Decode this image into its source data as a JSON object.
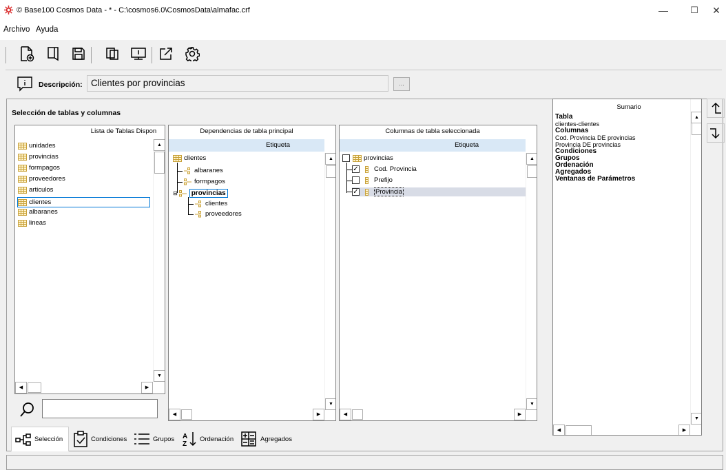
{
  "window": {
    "title": "© Base100 Cosmos Data - * - C:\\cosmos6.0\\CosmosData\\almafac.crf",
    "minimize": "—",
    "maximize": "☐",
    "close": "✕"
  },
  "menu": [
    "Archivo",
    "Ayuda"
  ],
  "toolbar_icons": [
    "new-doc-icon",
    "open-icon",
    "save-icon",
    "copy-icon",
    "preview-icon",
    "export-icon",
    "settings-icon"
  ],
  "description": {
    "label": "Descripción:",
    "value": "Clientes por provincias",
    "button": "..."
  },
  "section_title": "Selección de tablas y columnas",
  "tables_panel": {
    "header": "Lista de Tablas Dispon",
    "items": [
      "unidades",
      "provincias",
      "formpagos",
      "proveedores",
      "articulos",
      "clientes",
      "albaranes",
      "lineas"
    ],
    "selected": "clientes"
  },
  "dependencies_panel": {
    "header": "Dependencias de tabla principal",
    "subheader": "Etiqueta",
    "root": "clientes",
    "children": [
      "albaranes",
      "formpagos",
      "provincias"
    ],
    "selected": "provincias",
    "grandchildren": [
      "clientes",
      "proveedores"
    ]
  },
  "columns_panel": {
    "header": "Columnas de tabla seleccionada",
    "subheader": "Etiqueta",
    "root": "provincias",
    "columns": [
      {
        "label": "Cod. Provincia",
        "checked": true
      },
      {
        "label": "Prefijo",
        "checked": false
      },
      {
        "label": "Provincia",
        "checked": true
      }
    ]
  },
  "summary_panel": {
    "header": "Sumario",
    "lines": [
      {
        "text": "Tabla",
        "bold": true
      },
      {
        "text": "clientes-clientes",
        "bold": false
      },
      {
        "text": "Columnas",
        "bold": true
      },
      {
        "text": "Cod. Provincia DE provincias",
        "bold": false
      },
      {
        "text": "Provincia DE provincias",
        "bold": false
      },
      {
        "text": "Condiciones",
        "bold": true
      },
      {
        "text": "Grupos",
        "bold": true
      },
      {
        "text": "Ordenación",
        "bold": true
      },
      {
        "text": "Agregados",
        "bold": true
      },
      {
        "text": "Ventanas de Parámetros",
        "bold": true
      }
    ]
  },
  "search": {
    "value": ""
  },
  "tabs": [
    {
      "label": "Selección",
      "active": true
    },
    {
      "label": "Condiciones",
      "active": false
    },
    {
      "label": "Grupos",
      "active": false
    },
    {
      "label": "Ordenación",
      "active": false
    },
    {
      "label": "Agregados",
      "active": false
    }
  ],
  "colors": {
    "accent": "#0078d7",
    "selection": "#cce8ff",
    "header_blue": "#d9e8f6",
    "app_icon": "#d92a2a"
  }
}
